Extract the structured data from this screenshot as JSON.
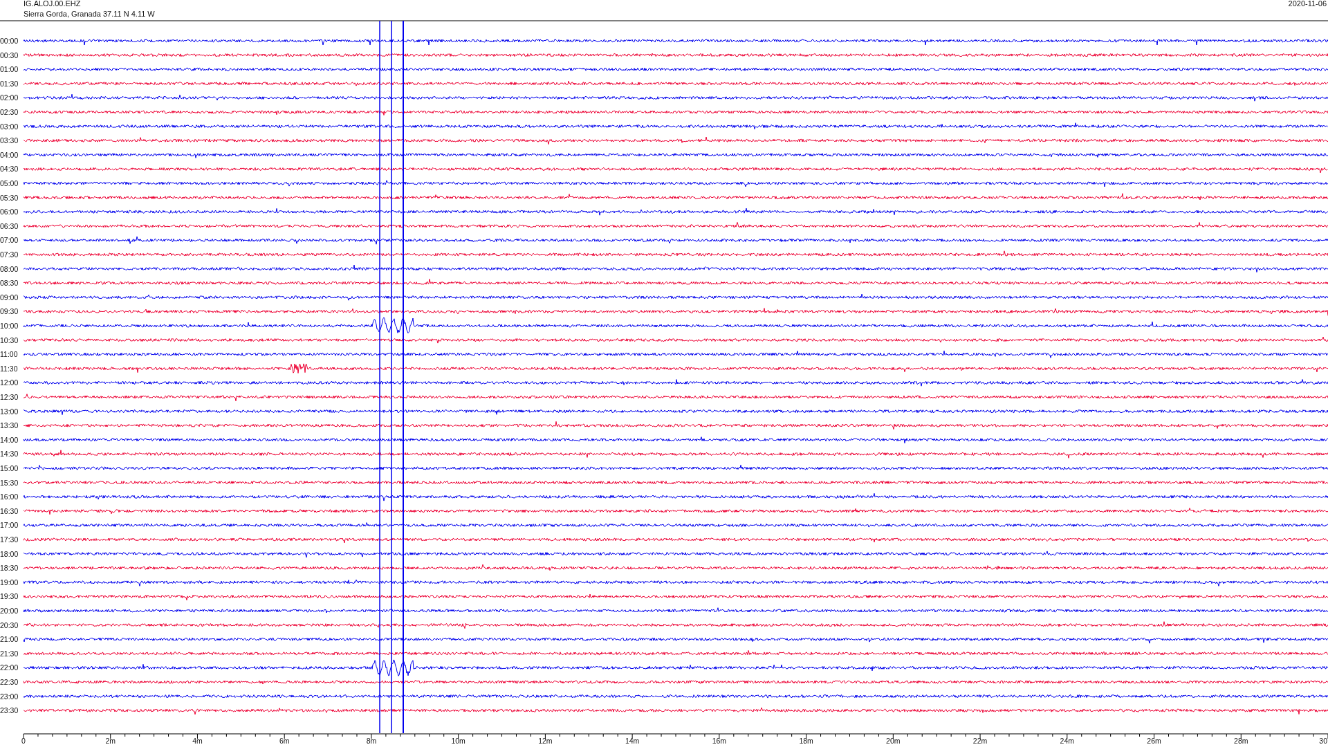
{
  "header": {
    "station": "IG.ALOJ.00.EHZ",
    "location": "Sierra Gorda, Granada  37.11 N 4.11 W",
    "date": "2020-11-06"
  },
  "rows": [
    {
      "time": "00:00",
      "color": "#0000ee"
    },
    {
      "time": "00:30",
      "color": "#ee0033"
    },
    {
      "time": "01:00",
      "color": "#0000ee"
    },
    {
      "time": "01:30",
      "color": "#ee0033"
    },
    {
      "time": "02:00",
      "color": "#0000ee"
    },
    {
      "time": "02:30",
      "color": "#ee0033"
    },
    {
      "time": "03:00",
      "color": "#0000ee"
    },
    {
      "time": "03:30",
      "color": "#ee0033"
    },
    {
      "time": "04:00",
      "color": "#0000ee"
    },
    {
      "time": "04:30",
      "color": "#ee0033"
    },
    {
      "time": "05:00",
      "color": "#0000ee"
    },
    {
      "time": "05:30",
      "color": "#ee0033"
    },
    {
      "time": "06:00",
      "color": "#0000ee"
    },
    {
      "time": "06:30",
      "color": "#ee0033"
    },
    {
      "time": "07:00",
      "color": "#0000ee"
    },
    {
      "time": "07:30",
      "color": "#ee0033"
    },
    {
      "time": "08:00",
      "color": "#0000ee"
    },
    {
      "time": "08:30",
      "color": "#ee0033"
    },
    {
      "time": "09:00",
      "color": "#0000ee"
    },
    {
      "time": "09:30",
      "color": "#ee0033"
    },
    {
      "time": "10:00",
      "color": "#0000ee"
    },
    {
      "time": "10:30",
      "color": "#ee0033"
    },
    {
      "time": "11:00",
      "color": "#0000ee"
    },
    {
      "time": "11:30",
      "color": "#ee0033"
    },
    {
      "time": "12:00",
      "color": "#0000ee"
    },
    {
      "time": "12:30",
      "color": "#ee0033"
    },
    {
      "time": "13:00",
      "color": "#0000ee"
    },
    {
      "time": "13:30",
      "color": "#ee0033"
    },
    {
      "time": "14:00",
      "color": "#0000ee"
    },
    {
      "time": "14:30",
      "color": "#ee0033"
    },
    {
      "time": "15:00",
      "color": "#0000ee"
    },
    {
      "time": "15:30",
      "color": "#ee0033"
    },
    {
      "time": "16:00",
      "color": "#0000ee"
    },
    {
      "time": "16:30",
      "color": "#ee0033"
    },
    {
      "time": "17:00",
      "color": "#0000ee"
    },
    {
      "time": "17:30",
      "color": "#ee0033"
    },
    {
      "time": "18:00",
      "color": "#0000ee"
    },
    {
      "time": "18:30",
      "color": "#ee0033"
    },
    {
      "time": "19:00",
      "color": "#0000ee"
    },
    {
      "time": "19:30",
      "color": "#ee0033"
    },
    {
      "time": "20:00",
      "color": "#0000ee"
    },
    {
      "time": "20:30",
      "color": "#ee0033"
    },
    {
      "time": "21:00",
      "color": "#0000ee"
    },
    {
      "time": "21:30",
      "color": "#ee0033"
    },
    {
      "time": "22:00",
      "color": "#0000ee"
    },
    {
      "time": "22:30",
      "color": "#ee0033"
    },
    {
      "time": "23:00",
      "color": "#0000ee"
    },
    {
      "time": "23:30",
      "color": "#ee0033"
    }
  ],
  "x_axis": {
    "labels": [
      "0",
      "2m",
      "4m",
      "6m",
      "8m",
      "10m",
      "12m",
      "14m",
      "16m",
      "18m",
      "20m",
      "22m",
      "24m",
      "26m",
      "28m",
      "30"
    ]
  }
}
